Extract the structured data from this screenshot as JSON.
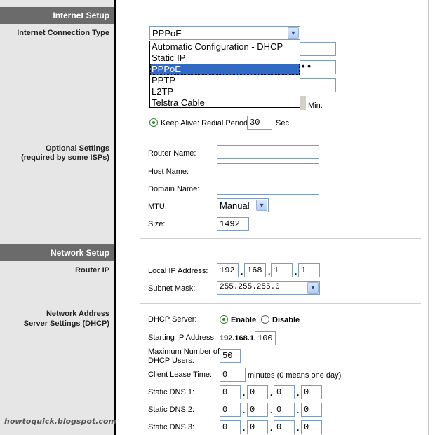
{
  "sections": {
    "internet_setup": "Internet Setup",
    "network_setup": "Network Setup"
  },
  "left_labels": {
    "connection_type": "Internet Connection Type",
    "optional_1": "Optional Settings",
    "optional_2": "(required by some ISPs)",
    "router_ip": "Router IP",
    "nas_1": "Network Address",
    "nas_2": "Server Settings (DHCP)"
  },
  "connection": {
    "selected": "PPPoE",
    "options": [
      "Automatic Configuration - DHCP",
      "Static IP",
      "PPPoE",
      "PPTP",
      "L2TP",
      "Telstra Cable"
    ],
    "password_mask": "••",
    "min_unit": "Min.",
    "keep_alive_label": "Keep Alive: Redial Period",
    "redial_period": "30",
    "sec_unit": "Sec."
  },
  "optional": {
    "router_name_label": "Router Name:",
    "router_name": "",
    "host_name_label": "Host Name:",
    "host_name": "",
    "domain_name_label": "Domain Name:",
    "domain_name": "",
    "mtu_label": "MTU:",
    "mtu_value": "Manual",
    "size_label": "Size:",
    "size_value": "1492"
  },
  "router_ip": {
    "local_ip_label": "Local IP Address:",
    "octets": [
      "192",
      "168",
      "1",
      "1"
    ],
    "subnet_label": "Subnet Mask:",
    "subnet_value": "255.255.255.0"
  },
  "dhcp": {
    "server_label": "DHCP Server:",
    "enable_label": "Enable",
    "disable_label": "Disable",
    "start_ip_label": "Starting IP Address:",
    "start_ip_prefix": "192.168.1.",
    "start_ip_last": "100",
    "max_users_label_1": "Maximum Number of",
    "max_users_label_2": "DHCP Users:",
    "max_users": "50",
    "lease_label": "Client Lease Time:",
    "lease_value": "0",
    "lease_note": "minutes (0 means one day)",
    "dns1_label": "Static DNS 1:",
    "dns1": [
      "0",
      "0",
      "0",
      "0"
    ],
    "dns2_label": "Static DNS 2:",
    "dns2": [
      "0",
      "0",
      "0",
      "0"
    ],
    "dns3_label": "Static DNS 3:",
    "dns3": [
      "0",
      "0",
      "0",
      "0"
    ]
  },
  "watermark": "howtoquick.blogspot.com"
}
